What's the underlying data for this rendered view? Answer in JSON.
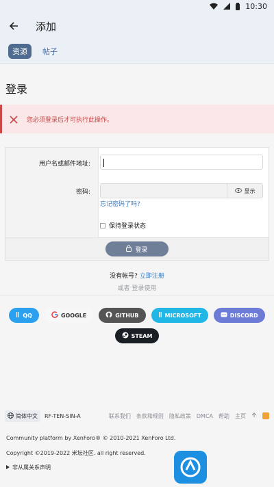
{
  "status": {
    "time": "10:30"
  },
  "app_bar": {
    "title": "添加"
  },
  "tabs": [
    {
      "label": "资源"
    },
    {
      "label": "帖子"
    }
  ],
  "page": {
    "title": "登录",
    "error": "您必须登录后才可执行此操作。"
  },
  "form": {
    "username_label": "用户名或邮件地址:",
    "password_label": "密码:",
    "reveal_label": "显示",
    "forgot": "忘记密码了吗?",
    "remember": "保持登录状态",
    "login_button": "登录"
  },
  "no_account": {
    "text": "没有帐号?",
    "link": "立即注册"
  },
  "or_use": "或者 登录使用",
  "providers": {
    "row1": [
      "QQ",
      "GOOGLE",
      "GITHUB",
      "MICROSOFT",
      "DISCORD"
    ],
    "row2": [
      "STEAM"
    ]
  },
  "footer": {
    "lang": "简体中文",
    "style": "RF-TEN-SIN-A",
    "links": [
      "联系我们",
      "条款和规则",
      "隐私政策",
      "DMCA",
      "帮助",
      "主页"
    ],
    "line1": "Community platform by XenForo® © 2010-2021 XenForo Ltd.",
    "line2": "Copyright ©2019-2022 米坛社区. all right reserved.",
    "line3": "非从属关系声明"
  },
  "colors": {
    "accent": "#4f6b8f",
    "error": "#c84848",
    "link": "#3b7bbf"
  }
}
